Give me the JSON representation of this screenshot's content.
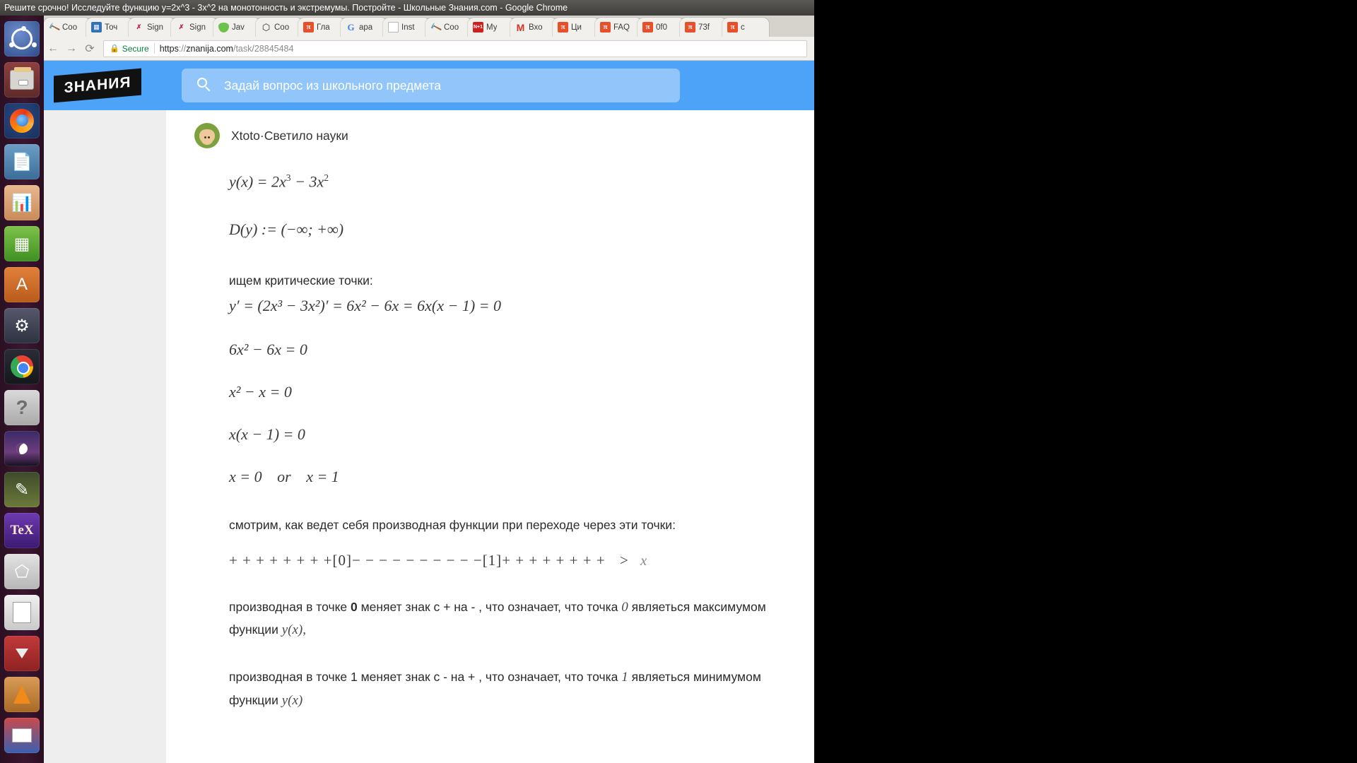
{
  "window": {
    "title": "Решите срочно! Исследуйте функцию y=2x^3 - 3x^2 на монотонность и экстремумы. Постройте - Школьные Знания.com - Google Chrome"
  },
  "browser": {
    "nav": {
      "back": "←",
      "forward": "→",
      "reload": "⟳"
    },
    "omnibox": {
      "lock_icon": "lock-icon",
      "secure_label": "Secure",
      "url_scheme": "https",
      "url_sep": "://",
      "url_host": "znanija.com",
      "url_path": "/task/28845484"
    },
    "tabs": [
      {
        "label": "Coo",
        "icon": "tool-icon",
        "icon_glyph": "🔨"
      },
      {
        "label": "Точ",
        "icon": "grid-icon",
        "icon_glyph": "▦"
      },
      {
        "label": "Sign",
        "icon": "signx-icon",
        "icon_glyph": "●✗"
      },
      {
        "label": "Sign",
        "icon": "signx-icon",
        "icon_glyph": "●✗"
      },
      {
        "label": "Jav",
        "icon": "java-leaf-icon",
        "icon_glyph": ""
      },
      {
        "label": "Coo",
        "icon": "hexagon-icon",
        "icon_glyph": "⬡"
      },
      {
        "label": "Гла",
        "icon": "pi-icon",
        "icon_glyph": "π"
      },
      {
        "label": "apa",
        "icon": "google-icon",
        "icon_glyph": "G"
      },
      {
        "label": "Inst",
        "icon": "document-icon",
        "icon_glyph": ""
      },
      {
        "label": "Coo",
        "icon": "tool-icon",
        "icon_glyph": "🔨"
      },
      {
        "label": "Му",
        "icon": "nplus1-icon",
        "icon_glyph": "N+1"
      },
      {
        "label": "Вхо",
        "icon": "gmail-icon",
        "icon_glyph": "M"
      },
      {
        "label": "Ци",
        "icon": "pi-icon",
        "icon_glyph": "π"
      },
      {
        "label": "FAQ",
        "icon": "pi-icon",
        "icon_glyph": "π"
      },
      {
        "label": "0f0",
        "icon": "pi-icon",
        "icon_glyph": "π"
      },
      {
        "label": "73f",
        "icon": "pi-icon",
        "icon_glyph": "π"
      },
      {
        "label": "c",
        "icon": "pi-icon",
        "icon_glyph": "π"
      }
    ]
  },
  "site": {
    "logo_text": "ЗНАНИЯ",
    "search_placeholder": "Задай вопрос из школьного предмета",
    "search_value": "",
    "header_color": "#4da3f7",
    "search_field_color": "#92c6fb"
  },
  "answer": {
    "author_name": "Xtoto",
    "author_separator": " · ",
    "author_rank": "Светило науки",
    "avatar": "cat-avatar",
    "formula_function_lhs": "y(x) = 2x",
    "formula_function_exp1": "3",
    "formula_function_mid": " − 3x",
    "formula_function_exp2": "2",
    "domain_lhs": "D(y) := (−∞; +∞)",
    "label_critical_points": "ищем критические точки:",
    "derivative_line": "y′ = (2x³ − 3x²)′ = 6x² − 6x = 6x(x − 1) = 0",
    "eq_line_1": "6x² − 6x = 0",
    "eq_line_2": "x² − x = 0",
    "eq_line_3": "x(x − 1) = 0",
    "eq_line_4_a": "x = 0",
    "eq_line_4_or": "or",
    "eq_line_4_b": "x = 1",
    "paragraph_behaviour": "смотрим, как ведет себя производная функции при переходе через эти точки:",
    "sign_line_plus_1": "+ + + + + + + +",
    "sign_line_zero": "[0]",
    "sign_line_minus": "− − − − − − − − − −",
    "sign_line_one": "[1]",
    "sign_line_plus_2": "+ + + + + + + +",
    "sign_line_arrow": ">",
    "sign_line_var": "x",
    "max_text_a": "производная в точке ",
    "max_point": "0",
    "max_text_b": " меняет знак с + на - , что означает, что точка ",
    "max_point_math": "0",
    "max_text_c": "являеться максимумом функции ",
    "max_func_math": "y(x),",
    "min_text_a": "производная в точке 1 меняет знак с - на + , что означает, что точка ",
    "min_point_math": "1",
    "min_text_c": "являеться минимумом функции ",
    "min_func_math": "y(x)"
  },
  "launcher": {
    "items": [
      {
        "name": "ubuntu-dash-icon",
        "label": "Ubuntu",
        "running": false
      },
      {
        "name": "files-icon",
        "label": "Files",
        "running": true
      },
      {
        "name": "firefox-icon",
        "label": "Firefox",
        "running": false
      },
      {
        "name": "libreoffice-writer-icon",
        "label": "LibreOffice Writer",
        "running": true
      },
      {
        "name": "libreoffice-impress-icon",
        "label": "LibreOffice Impress",
        "running": false
      },
      {
        "name": "libreoffice-calc-icon",
        "label": "LibreOffice Calc",
        "running": true
      },
      {
        "name": "ubuntu-software-icon",
        "label": "Ubuntu Software",
        "running": false
      },
      {
        "name": "system-settings-icon",
        "label": "System Settings",
        "running": true
      },
      {
        "name": "google-chrome-icon",
        "label": "Google Chrome",
        "running": true
      },
      {
        "name": "help-icon",
        "label": "Help",
        "running": false
      },
      {
        "name": "stellarium-icon",
        "label": "Stellarium",
        "running": false
      },
      {
        "name": "inkscape-icon",
        "label": "Inkscape",
        "running": false
      },
      {
        "name": "texstudio-icon",
        "label": "TeXstudio",
        "running": true
      },
      {
        "name": "geogebra-icon",
        "label": "GeoGebra",
        "running": true
      },
      {
        "name": "text-editor-icon",
        "label": "Text Editor",
        "running": true
      },
      {
        "name": "transmission-icon",
        "label": "Transmission",
        "running": true
      },
      {
        "name": "vlc-icon",
        "label": "VLC Media Player",
        "running": true
      },
      {
        "name": "scanner-icon",
        "label": "Simple Scan",
        "running": true
      }
    ]
  }
}
